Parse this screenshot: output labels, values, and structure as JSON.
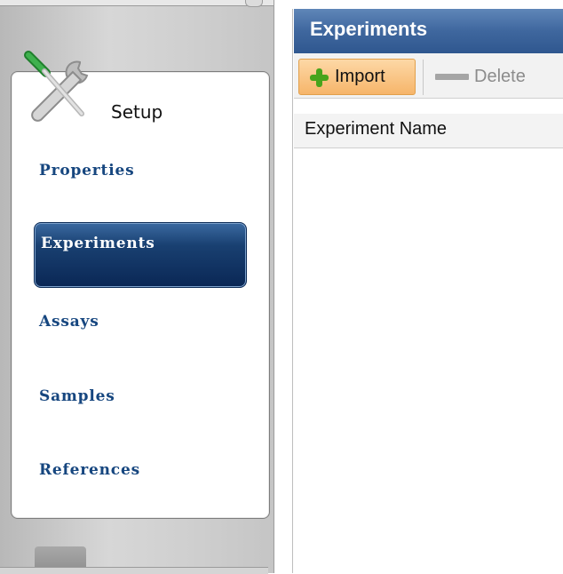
{
  "sidebar": {
    "section_title": "Setup",
    "items": [
      {
        "label": "Properties",
        "active": false
      },
      {
        "label": "Experiments",
        "active": true
      },
      {
        "label": "Assays",
        "active": false
      },
      {
        "label": "Samples",
        "active": false
      },
      {
        "label": "References",
        "active": false
      }
    ],
    "icons": [
      "tools-icon"
    ]
  },
  "panel": {
    "title": "Experiments",
    "toolbar": {
      "import_label": "Import",
      "delete_label": "Delete"
    },
    "table": {
      "columns": [
        "Experiment Name"
      ],
      "rows": []
    }
  },
  "colors": {
    "header_blue": "#3f679e",
    "nav_text_blue": "#16467f",
    "active_nav_bg": "#0a2755",
    "import_button_bg": "#f6b56a"
  }
}
